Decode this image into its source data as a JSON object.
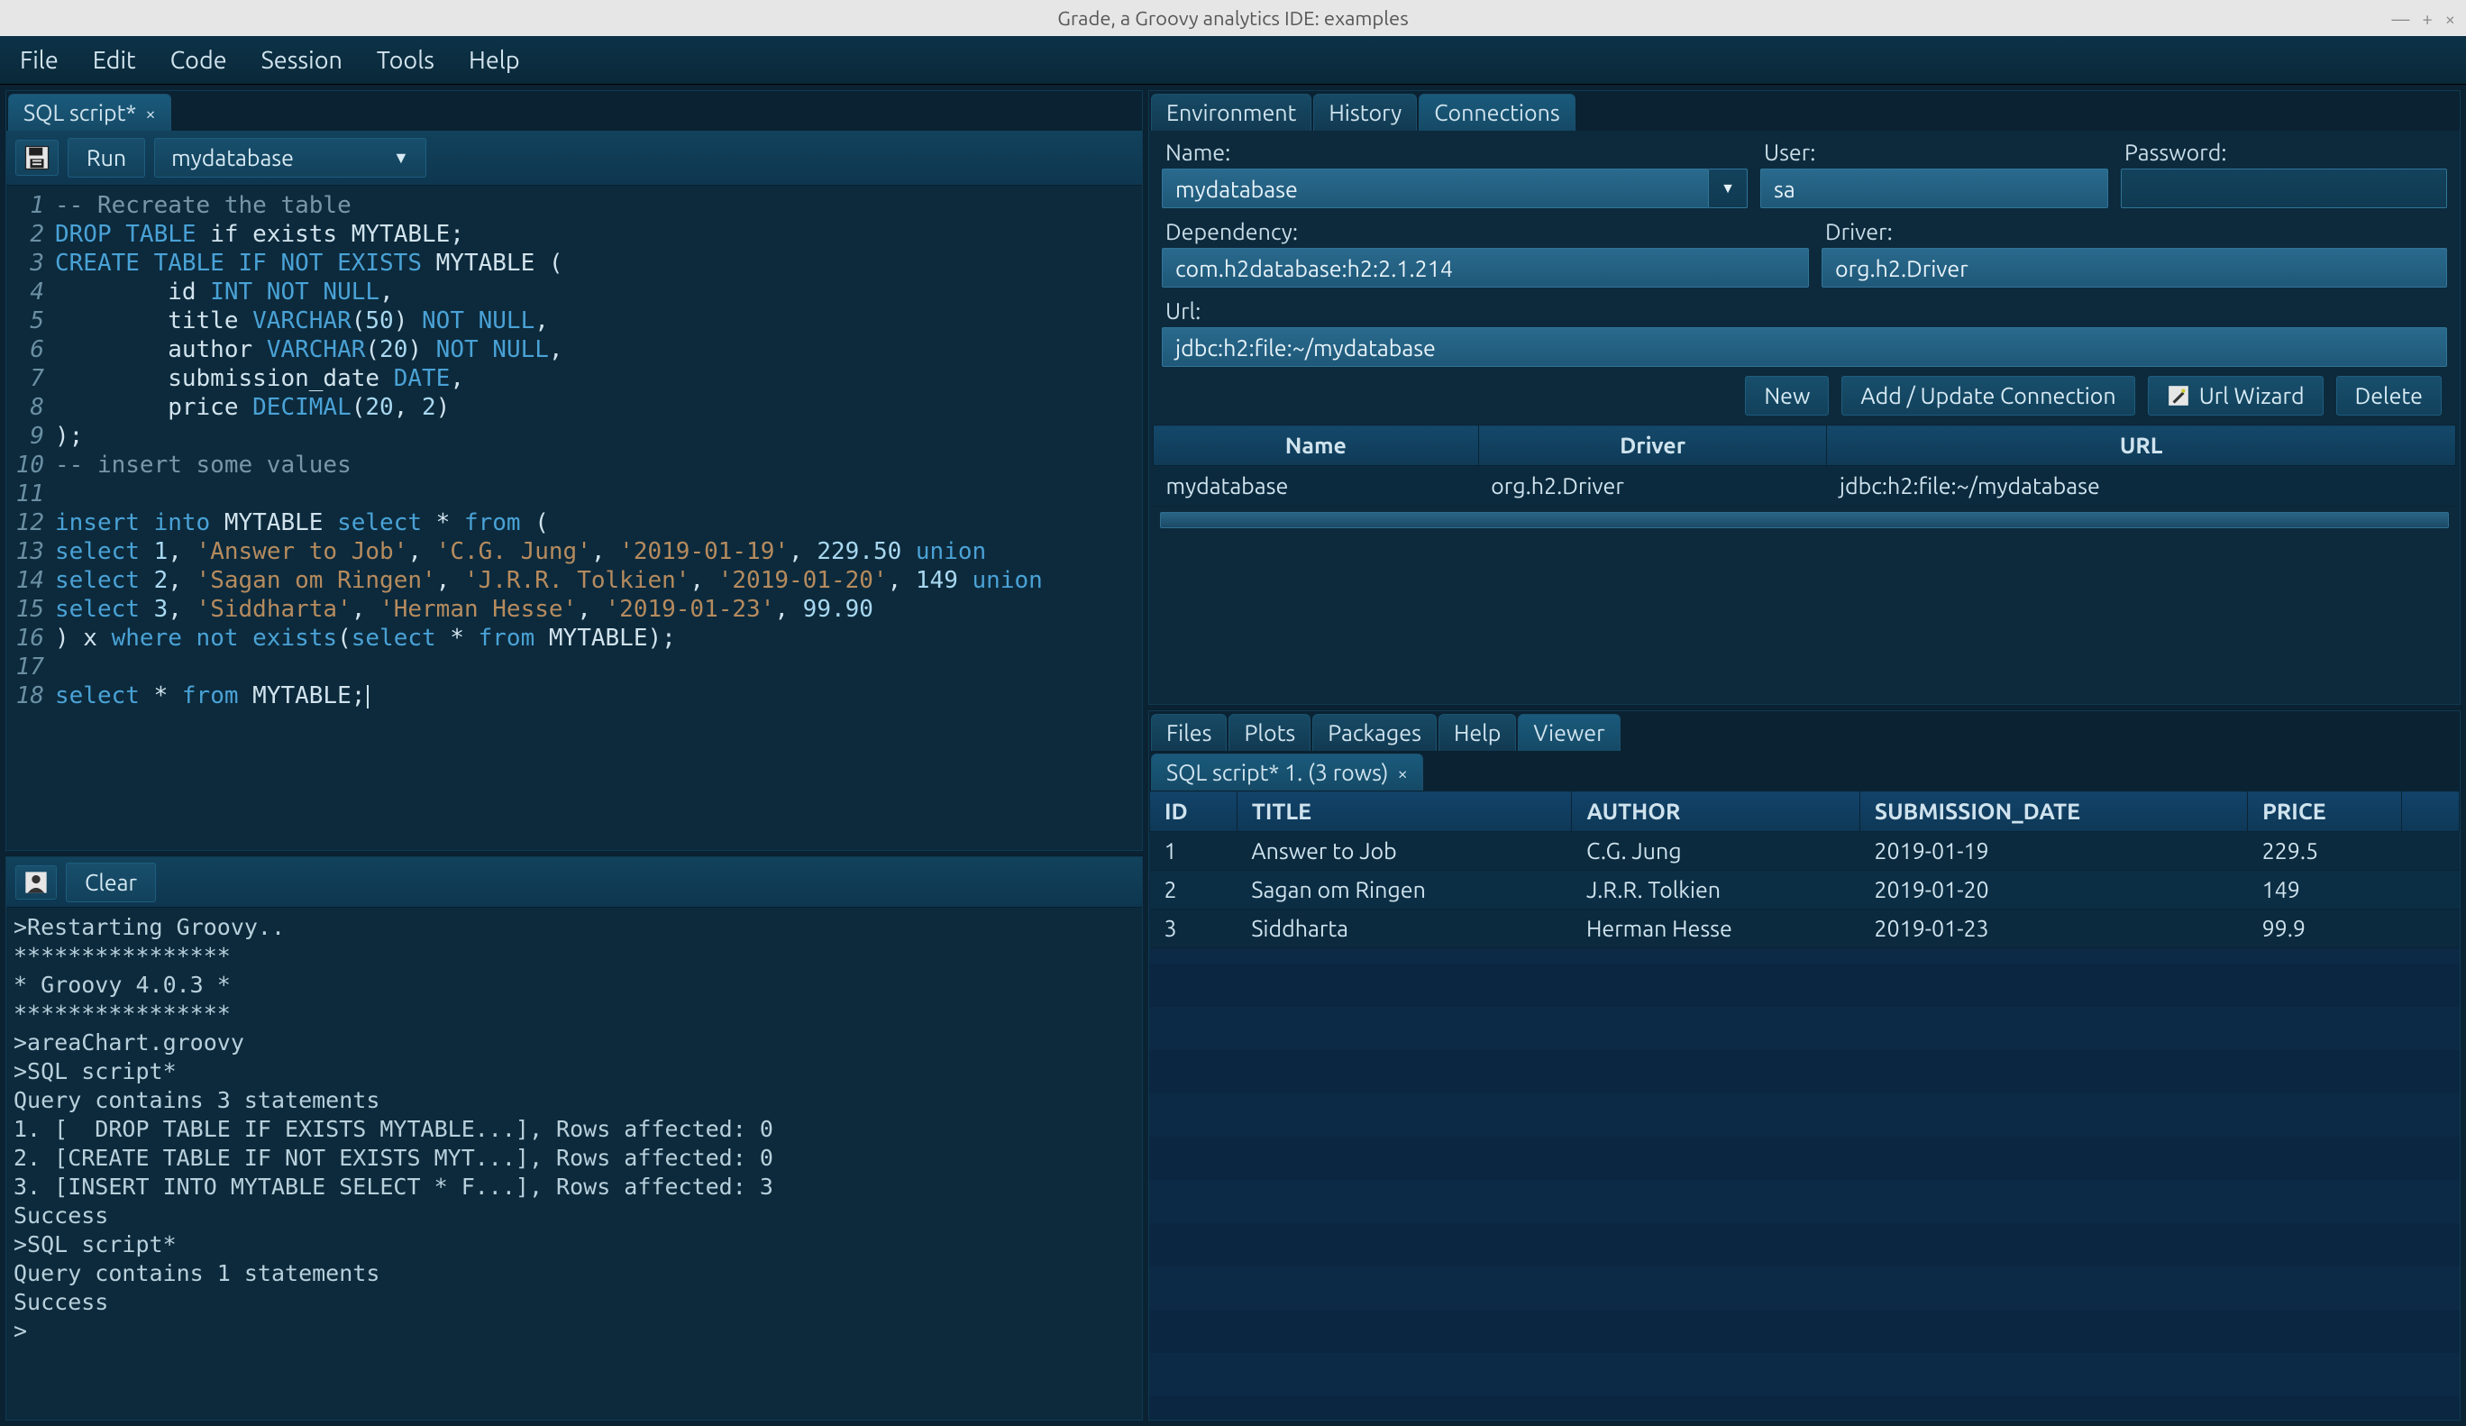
{
  "window": {
    "title": "Grade, a Groovy analytics IDE: examples"
  },
  "menubar": [
    "File",
    "Edit",
    "Code",
    "Session",
    "Tools",
    "Help"
  ],
  "left": {
    "tab": {
      "label": "SQL script*"
    },
    "toolbar": {
      "run": "Run",
      "db_selected": "mydatabase"
    },
    "code": {
      "lines": [
        {
          "n": "1",
          "seg": [
            {
              "t": "-- Recreate the table",
              "c": "c-comment"
            }
          ]
        },
        {
          "n": "2",
          "seg": [
            {
              "t": "DROP TABLE",
              "c": "c-kw"
            },
            {
              "t": " if exists MYTABLE;",
              "c": ""
            }
          ]
        },
        {
          "n": "3",
          "seg": [
            {
              "t": "CREATE TABLE IF NOT EXISTS",
              "c": "c-kw"
            },
            {
              "t": " MYTABLE (",
              "c": ""
            }
          ]
        },
        {
          "n": "4",
          "seg": [
            {
              "t": "        id ",
              "c": ""
            },
            {
              "t": "INT NOT NULL",
              "c": "c-kw"
            },
            {
              "t": ",",
              "c": ""
            }
          ]
        },
        {
          "n": "5",
          "seg": [
            {
              "t": "        title ",
              "c": ""
            },
            {
              "t": "VARCHAR",
              "c": "c-kw"
            },
            {
              "t": "(",
              "c": ""
            },
            {
              "t": "50",
              "c": "c-num"
            },
            {
              "t": ") ",
              "c": ""
            },
            {
              "t": "NOT NULL",
              "c": "c-kw"
            },
            {
              "t": ",",
              "c": ""
            }
          ]
        },
        {
          "n": "6",
          "seg": [
            {
              "t": "        author ",
              "c": ""
            },
            {
              "t": "VARCHAR",
              "c": "c-kw"
            },
            {
              "t": "(",
              "c": ""
            },
            {
              "t": "20",
              "c": "c-num"
            },
            {
              "t": ") ",
              "c": ""
            },
            {
              "t": "NOT NULL",
              "c": "c-kw"
            },
            {
              "t": ",",
              "c": ""
            }
          ]
        },
        {
          "n": "7",
          "seg": [
            {
              "t": "        submission_date ",
              "c": ""
            },
            {
              "t": "DATE",
              "c": "c-kw"
            },
            {
              "t": ",",
              "c": ""
            }
          ]
        },
        {
          "n": "8",
          "seg": [
            {
              "t": "        price ",
              "c": ""
            },
            {
              "t": "DECIMAL",
              "c": "c-kw"
            },
            {
              "t": "(",
              "c": ""
            },
            {
              "t": "20",
              "c": "c-num"
            },
            {
              "t": ", ",
              "c": ""
            },
            {
              "t": "2",
              "c": "c-num"
            },
            {
              "t": ")",
              "c": ""
            }
          ]
        },
        {
          "n": "9",
          "seg": [
            {
              "t": ");",
              "c": ""
            }
          ]
        },
        {
          "n": "10",
          "seg": [
            {
              "t": "-- insert some values",
              "c": "c-comment"
            }
          ]
        },
        {
          "n": "11",
          "seg": [
            {
              "t": "",
              "c": ""
            }
          ]
        },
        {
          "n": "12",
          "seg": [
            {
              "t": "insert into",
              "c": "c-kw"
            },
            {
              "t": " MYTABLE ",
              "c": ""
            },
            {
              "t": "select",
              "c": "c-kw"
            },
            {
              "t": " * ",
              "c": ""
            },
            {
              "t": "from",
              "c": "c-kw"
            },
            {
              "t": " (",
              "c": ""
            }
          ]
        },
        {
          "n": "13",
          "seg": [
            {
              "t": "select",
              "c": "c-kw"
            },
            {
              "t": " ",
              "c": ""
            },
            {
              "t": "1",
              "c": "c-num"
            },
            {
              "t": ", ",
              "c": ""
            },
            {
              "t": "'Answer to Job'",
              "c": "c-str"
            },
            {
              "t": ", ",
              "c": ""
            },
            {
              "t": "'C.G. Jung'",
              "c": "c-str"
            },
            {
              "t": ", ",
              "c": ""
            },
            {
              "t": "'2019-01-19'",
              "c": "c-str"
            },
            {
              "t": ", ",
              "c": ""
            },
            {
              "t": "229.50",
              "c": "c-num"
            },
            {
              "t": " ",
              "c": ""
            },
            {
              "t": "union",
              "c": "c-kw"
            }
          ]
        },
        {
          "n": "14",
          "seg": [
            {
              "t": "select",
              "c": "c-kw"
            },
            {
              "t": " ",
              "c": ""
            },
            {
              "t": "2",
              "c": "c-num"
            },
            {
              "t": ", ",
              "c": ""
            },
            {
              "t": "'Sagan om Ringen'",
              "c": "c-str"
            },
            {
              "t": ", ",
              "c": ""
            },
            {
              "t": "'J.R.R. Tolkien'",
              "c": "c-str"
            },
            {
              "t": ", ",
              "c": ""
            },
            {
              "t": "'2019-01-20'",
              "c": "c-str"
            },
            {
              "t": ", ",
              "c": ""
            },
            {
              "t": "149",
              "c": "c-num"
            },
            {
              "t": " ",
              "c": ""
            },
            {
              "t": "union",
              "c": "c-kw"
            }
          ]
        },
        {
          "n": "15",
          "seg": [
            {
              "t": "select",
              "c": "c-kw"
            },
            {
              "t": " ",
              "c": ""
            },
            {
              "t": "3",
              "c": "c-num"
            },
            {
              "t": ", ",
              "c": ""
            },
            {
              "t": "'Siddharta'",
              "c": "c-str"
            },
            {
              "t": ", ",
              "c": ""
            },
            {
              "t": "'Herman Hesse'",
              "c": "c-str"
            },
            {
              "t": ", ",
              "c": ""
            },
            {
              "t": "'2019-01-23'",
              "c": "c-str"
            },
            {
              "t": ", ",
              "c": ""
            },
            {
              "t": "99.90",
              "c": "c-num"
            }
          ]
        },
        {
          "n": "16",
          "seg": [
            {
              "t": ") x ",
              "c": ""
            },
            {
              "t": "where not exists",
              "c": "c-kw"
            },
            {
              "t": "(",
              "c": ""
            },
            {
              "t": "select",
              "c": "c-kw"
            },
            {
              "t": " * ",
              "c": ""
            },
            {
              "t": "from",
              "c": "c-kw"
            },
            {
              "t": " MYTABLE);",
              "c": ""
            }
          ]
        },
        {
          "n": "17",
          "seg": [
            {
              "t": "",
              "c": ""
            }
          ]
        },
        {
          "n": "18",
          "seg": [
            {
              "t": "select",
              "c": "c-kw"
            },
            {
              "t": " * ",
              "c": ""
            },
            {
              "t": "from",
              "c": "c-kw"
            },
            {
              "t": " MYTABLE;",
              "c": ""
            }
          ],
          "cursor": true
        }
      ]
    },
    "console": {
      "clear": "Clear",
      "text": ">Restarting Groovy..\n****************\n* Groovy 4.0.3 *\n****************\n>areaChart.groovy\n>SQL script*\nQuery contains 3 statements\n1. [  DROP TABLE IF EXISTS MYTABLE...], Rows affected: 0\n2. [CREATE TABLE IF NOT EXISTS MYT...], Rows affected: 0\n3. [INSERT INTO MYTABLE SELECT * F...], Rows affected: 3\nSuccess\n>SQL script*\nQuery contains 1 statements\nSuccess\n>"
    }
  },
  "right": {
    "top_tabs": [
      "Environment",
      "History",
      "Connections"
    ],
    "top_active": 2,
    "conn": {
      "labels": {
        "name": "Name:",
        "user": "User:",
        "password": "Password:",
        "dependency": "Dependency:",
        "driver": "Driver:",
        "url": "Url:"
      },
      "values": {
        "name": "mydatabase",
        "user": "sa",
        "password": "",
        "dependency": "com.h2database:h2:2.1.214",
        "driver": "org.h2.Driver",
        "url": "jdbc:h2:file:~/mydatabase"
      },
      "buttons": {
        "new": "New",
        "add": "Add / Update Connection",
        "wizard": "Url Wizard",
        "delete": "Delete"
      },
      "table": {
        "headers": [
          "Name",
          "Driver",
          "URL"
        ],
        "rows": [
          [
            "mydatabase",
            "org.h2.Driver",
            "jdbc:h2:file:~/mydatabase"
          ]
        ]
      }
    },
    "bottom_tabs": [
      "Files",
      "Plots",
      "Packages",
      "Help",
      "Viewer"
    ],
    "bottom_active": 4,
    "result_tab": "SQL script* 1. (3 rows)",
    "results": {
      "headers": [
        "ID",
        "TITLE",
        "AUTHOR",
        "SUBMISSION_DATE",
        "PRICE"
      ],
      "rows": [
        [
          "1",
          "Answer to Job",
          "C.G. Jung",
          "2019-01-19",
          "229.5"
        ],
        [
          "2",
          "Sagan om Ringen",
          "J.R.R. Tolkien",
          "2019-01-20",
          "149"
        ],
        [
          "3",
          "Siddharta",
          "Herman Hesse",
          "2019-01-23",
          "99.9"
        ]
      ]
    }
  }
}
